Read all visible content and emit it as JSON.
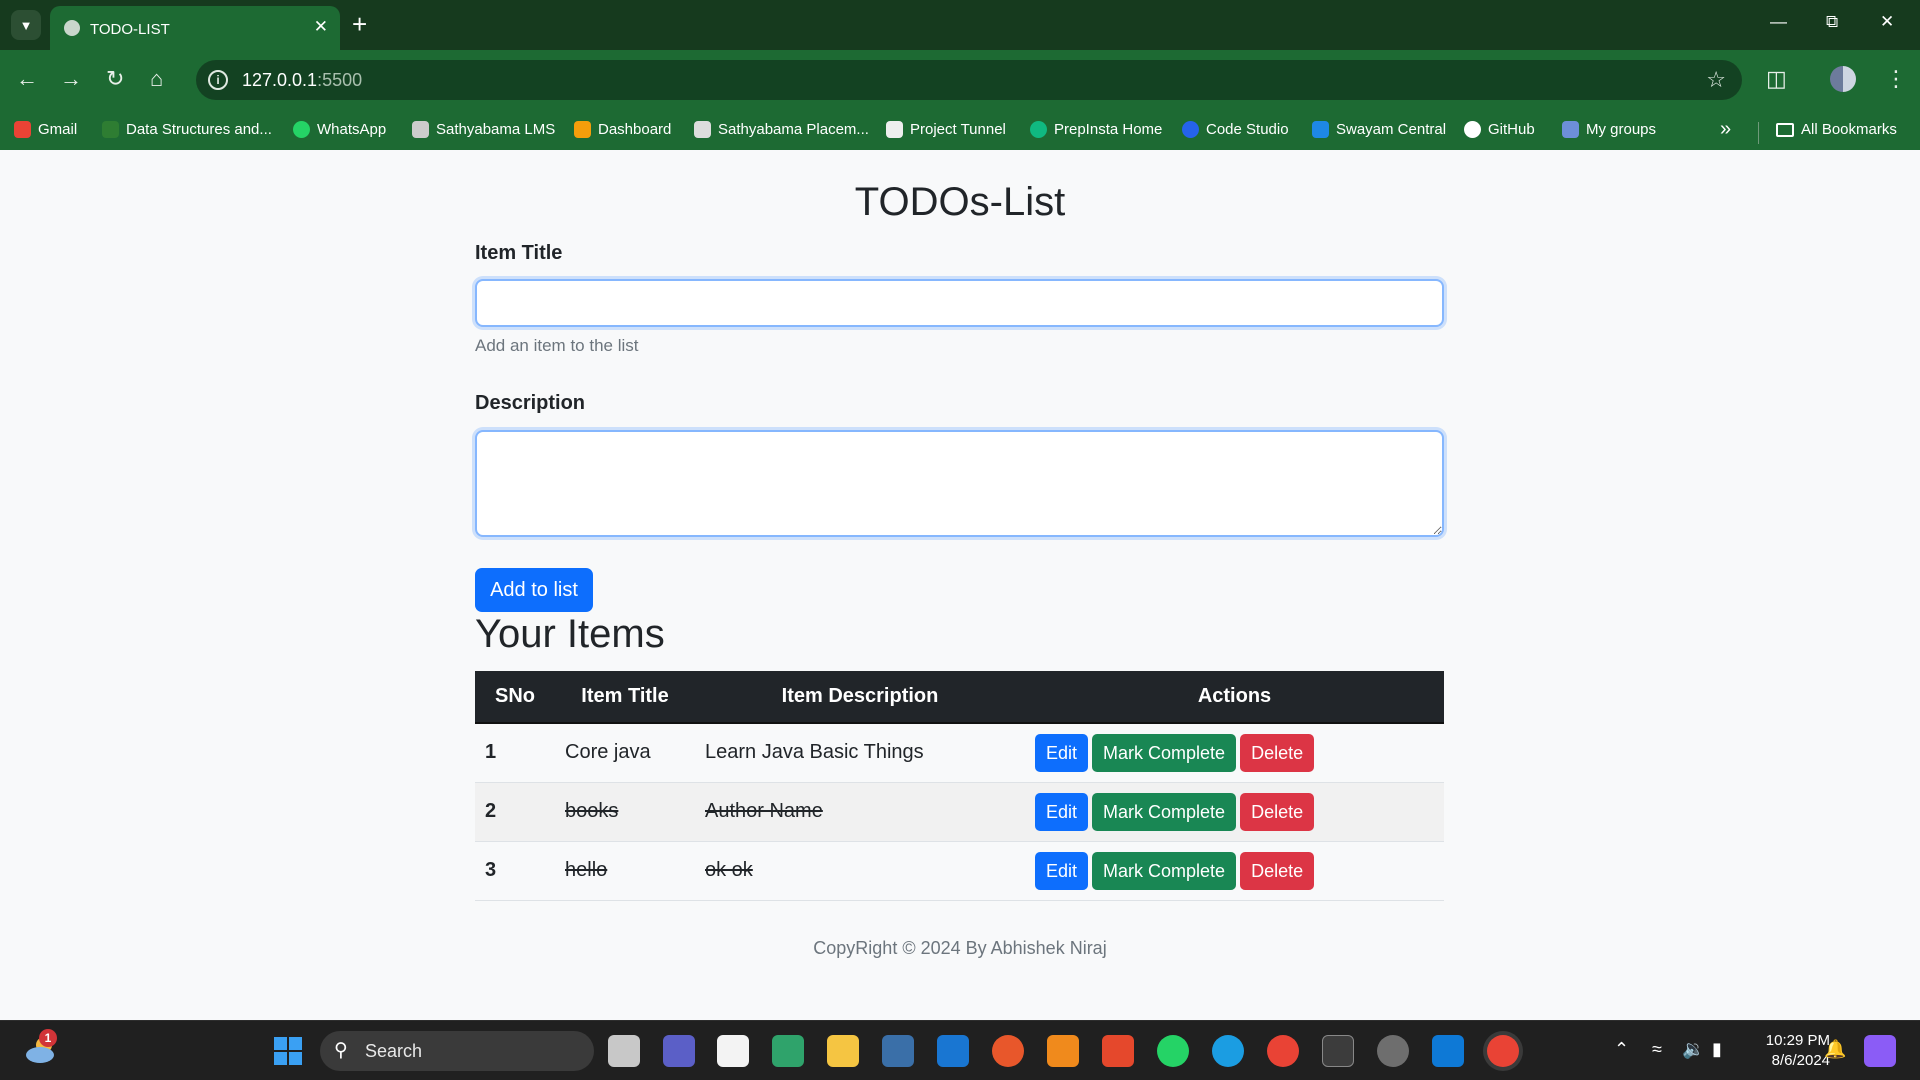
{
  "browser": {
    "tab_title": "TODO-LIST",
    "address_host": "127.0.0.1",
    "address_port": ":5500",
    "bookmarks": [
      {
        "label": "Gmail",
        "color": "#ea4335"
      },
      {
        "label": "Data Structures and...",
        "color": "#2e7d32"
      },
      {
        "label": "WhatsApp",
        "color": "#25d366"
      },
      {
        "label": "Sathyabama LMS",
        "color": "#cccccc"
      },
      {
        "label": "Dashboard",
        "color": "#f59e0b"
      },
      {
        "label": "Sathyabama Placem...",
        "color": "#dddddd"
      },
      {
        "label": "Project Tunnel",
        "color": "#eeeeee"
      },
      {
        "label": "PrepInsta Home",
        "color": "#10b981"
      },
      {
        "label": "Code Studio",
        "color": "#2563eb"
      },
      {
        "label": "Swayam Central",
        "color": "#1e88e5"
      },
      {
        "label": "GitHub",
        "color": "#ffffff"
      },
      {
        "label": "My groups",
        "color": "#6d8fd8"
      }
    ],
    "all_bookmarks": "All Bookmarks"
  },
  "page": {
    "title": "TODOs-List",
    "item_title_label": "Item Title",
    "item_title_hint": "Add an item to the list",
    "description_label": "Description",
    "add_button": "Add to list",
    "items_heading": "Your Items",
    "table": {
      "headers": [
        "SNo",
        "Item Title",
        "Item Description",
        "Actions"
      ],
      "rows": [
        {
          "sno": "1",
          "title": "Core java",
          "description": "Learn Java Basic Things",
          "completed": false
        },
        {
          "sno": "2",
          "title": "books",
          "description": "Author Name",
          "completed": true
        },
        {
          "sno": "3",
          "title": "hello",
          "description": "ok ok",
          "completed": true
        }
      ],
      "actions": {
        "edit": "Edit",
        "complete": "Mark Complete",
        "delete": "Delete"
      }
    },
    "footer": "CopyRight © 2024 By Abhishek Niraj"
  },
  "taskbar": {
    "search_label": "Search",
    "notification_count": "1",
    "time": "10:29 PM",
    "date": "8/6/2024"
  }
}
